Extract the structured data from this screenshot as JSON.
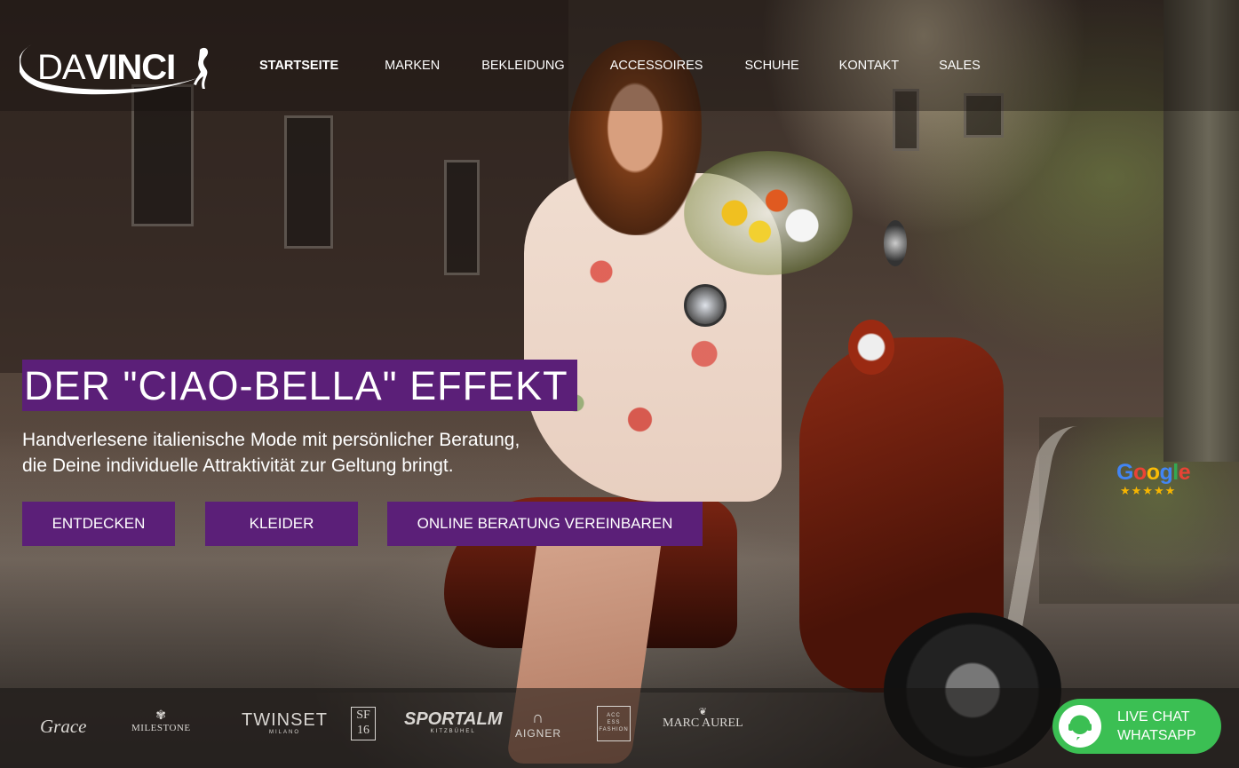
{
  "header": {
    "logo": {
      "part1": "DA",
      "part2": "VINCI"
    },
    "nav": [
      {
        "label": "STARTSEITE",
        "active": true
      },
      {
        "label": "MARKEN",
        "active": false
      },
      {
        "label": "BEKLEIDUNG",
        "active": false
      },
      {
        "label": "ACCESSOIRES",
        "active": false
      },
      {
        "label": "SCHUHE",
        "active": false
      },
      {
        "label": "KONTAKT",
        "active": false
      },
      {
        "label": "SALES",
        "active": false
      }
    ]
  },
  "hero": {
    "headline": "DER \"CIAO-BELLA\" EFFEKT",
    "subline": [
      "Handverlesene italienische Mode mit persönlicher Beratung,",
      "die Deine individuelle Attraktivität zur Geltung bringt."
    ],
    "buttons": [
      {
        "label": "ENTDECKEN"
      },
      {
        "label": "KLEIDER"
      },
      {
        "label": "ONLINE BERATUNG VEREINBAREN"
      }
    ]
  },
  "google_badge": {
    "word": [
      "G",
      "o",
      "o",
      "g",
      "l",
      "e"
    ],
    "stars": "★★★★★",
    "rating_stars": 5
  },
  "brands": {
    "grace": "Grace",
    "milestone": "MILESTONE",
    "twinset": "TWINSET",
    "twinset_sub": "MILANO",
    "sf_top": "SF",
    "sf_bottom": "16",
    "sportalm": "SPORTALM",
    "sportalm_sub": "KITZBÜHEL",
    "aigner": "AIGNER",
    "access_lines": [
      "ACC",
      "ESS",
      "FASHION"
    ],
    "marc": "MARC AUREL"
  },
  "whatsapp": {
    "line1": "LIVE CHAT",
    "line2": "WHATSAPP"
  },
  "colors": {
    "accent_purple": "#5b1f78",
    "whatsapp_green": "#3bbf53",
    "star_gold": "#f7b500"
  }
}
